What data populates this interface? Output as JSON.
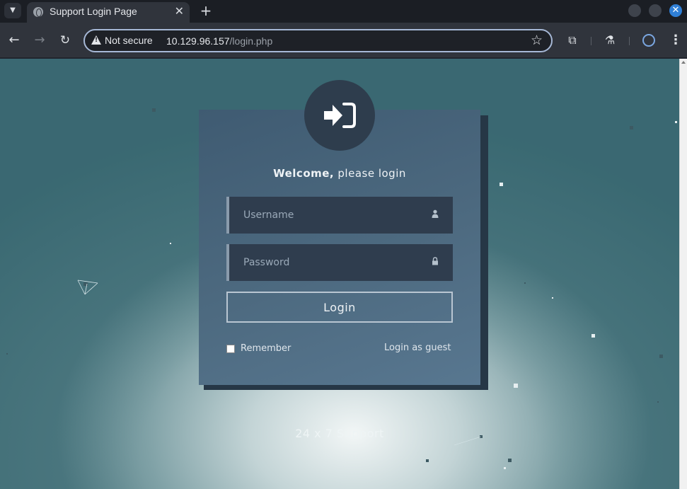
{
  "browser": {
    "tab_title": "Support Login Page",
    "tab_close": "✕",
    "new_tab": "+",
    "security_label": "Not secure",
    "url_host": "10.129.96.157",
    "url_path": "/login.php",
    "window_close": "✕"
  },
  "login": {
    "welcome_bold": "Welcome,",
    "welcome_rest": " please login",
    "username_placeholder": "Username",
    "password_placeholder": "Password",
    "login_button": "Login",
    "remember_label": "Remember",
    "remember_checked": false,
    "guest_link": "Login as guest"
  },
  "footer": {
    "text": "24 x 7 Support"
  },
  "icons": {
    "login": "sign-in-icon",
    "username": "user-icon",
    "password": "lock-icon"
  },
  "colors": {
    "card": "#4a677e",
    "field": "#2f3d4e",
    "circle": "#2e3d4d"
  }
}
